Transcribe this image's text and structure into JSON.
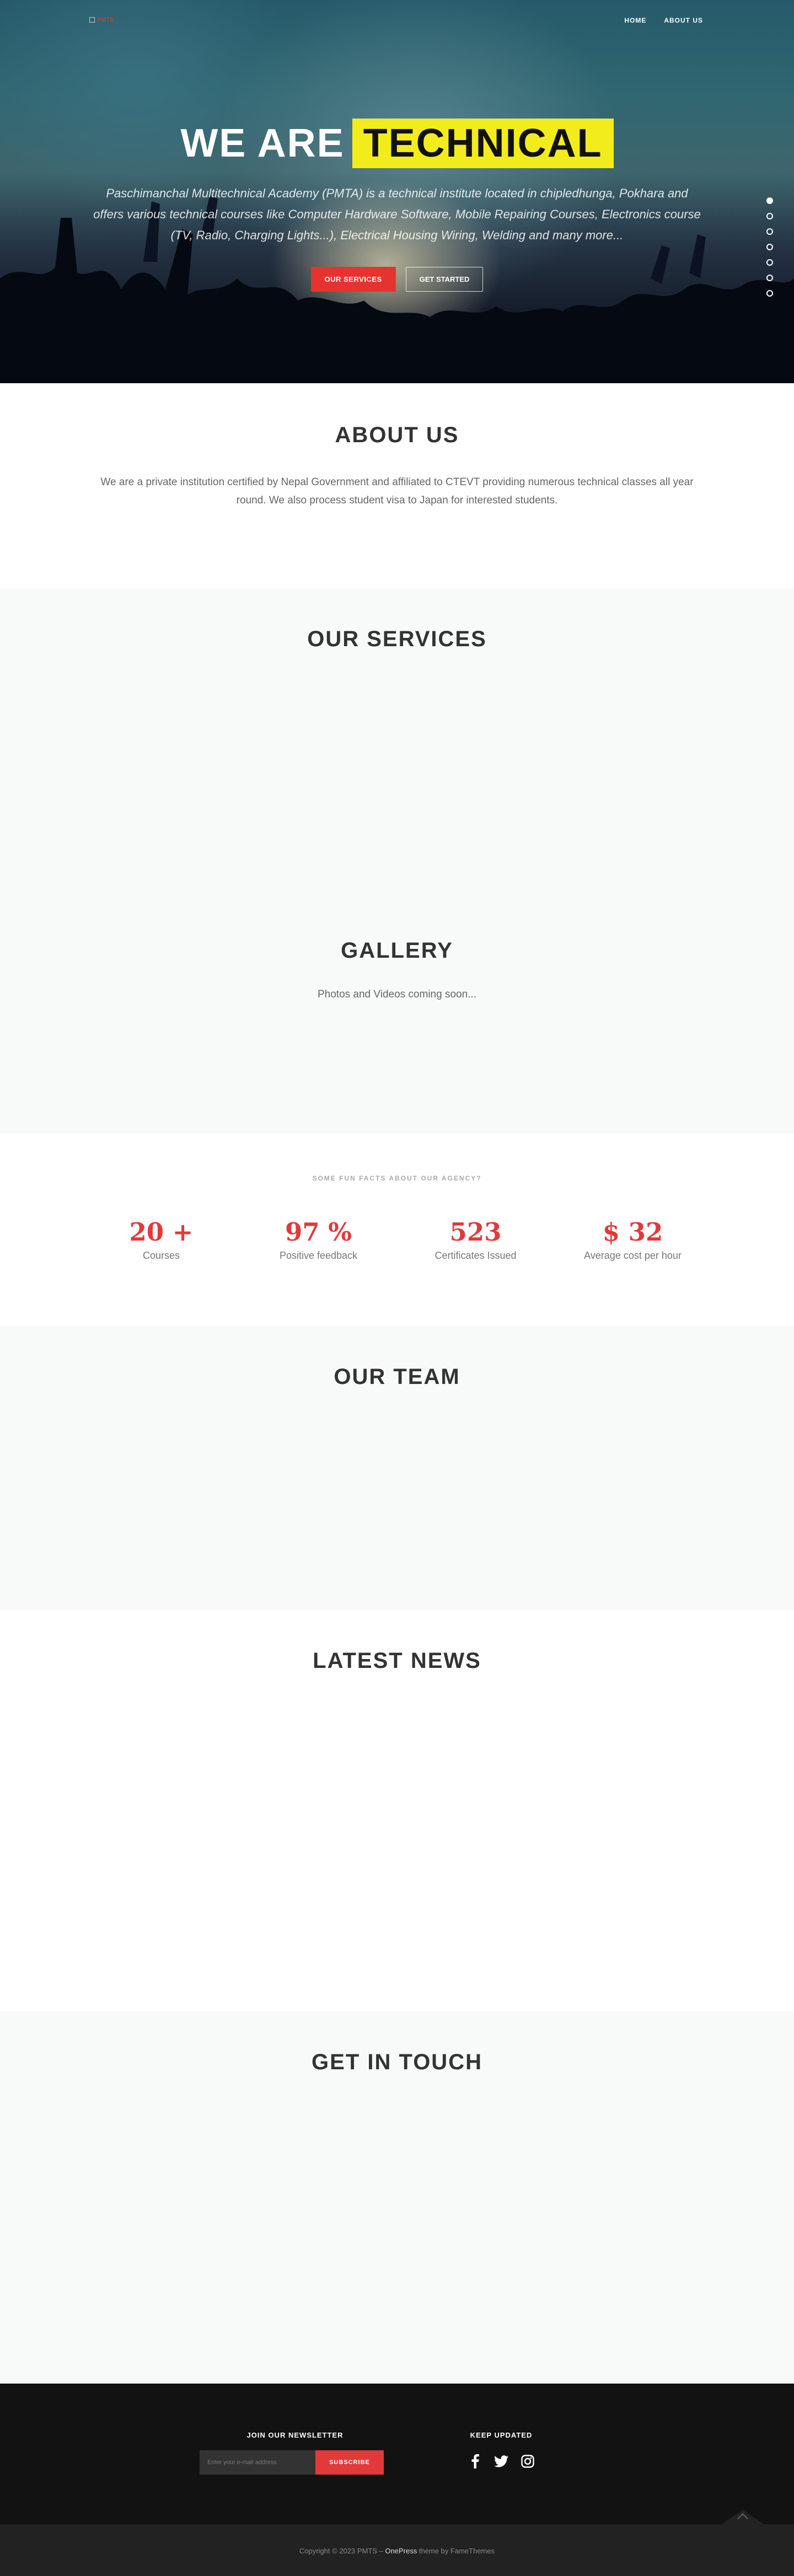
{
  "header": {
    "logo_alt": "PMTS",
    "nav": [
      {
        "label": "Home"
      },
      {
        "label": "About Us"
      }
    ]
  },
  "hero": {
    "title_prefix": "WE ARE",
    "title_highlight": "TECHNICAL",
    "description": "Paschimanchal Multitechnical Academy (PMTA) is a technical institute located in chipledhunga, Pokhara and offers various technical courses like Computer Hardware Software, Mobile Repairing Courses, Electronics course (TV, Radio, Charging Lights...), Electrical Housing Wiring, Welding and many more...",
    "primary_button": "Our Services",
    "secondary_button": "Get Started",
    "slide_dots": 7,
    "active_dot": 0
  },
  "about": {
    "title": "ABOUT US",
    "text": "We are a private institution certified by Nepal Government and affiliated to CTEVT providing numerous technical classes all year round. We also process student visa to Japan for interested students."
  },
  "services": {
    "title": "OUR SERVICES"
  },
  "gallery": {
    "title": "GALLERY",
    "text": "Photos and Videos coming soon..."
  },
  "facts": {
    "subtitle": "Some fun facts about our agency?",
    "items": [
      {
        "number": "20 +",
        "label": "Courses"
      },
      {
        "number": "97 %",
        "label": "Positive feedback"
      },
      {
        "number": "523",
        "label": "Certificates Issued"
      },
      {
        "number": "$ 32",
        "label": "Average cost per hour"
      }
    ]
  },
  "team": {
    "title": "OUR TEAM"
  },
  "news": {
    "title": "LATEST NEWS"
  },
  "contact": {
    "title": "GET IN TOUCH"
  },
  "footer": {
    "newsletter_title": "Join our Newsletter",
    "email_placeholder": "Enter your e-mail address",
    "subscribe_label": "Subscribe",
    "keep_updated_title": "Keep Updated",
    "social_icons": [
      "facebook-icon",
      "twitter-icon",
      "instagram-icon"
    ],
    "copyright_prefix": "Copyright © 2023 PMTS – ",
    "theme_name": "OnePress",
    "copyright_suffix": " theme by FameThemes"
  },
  "colors": {
    "accent_red": "#e23a3a",
    "highlight_yellow": "#f2ec1d",
    "footer_dark": "#121212"
  }
}
